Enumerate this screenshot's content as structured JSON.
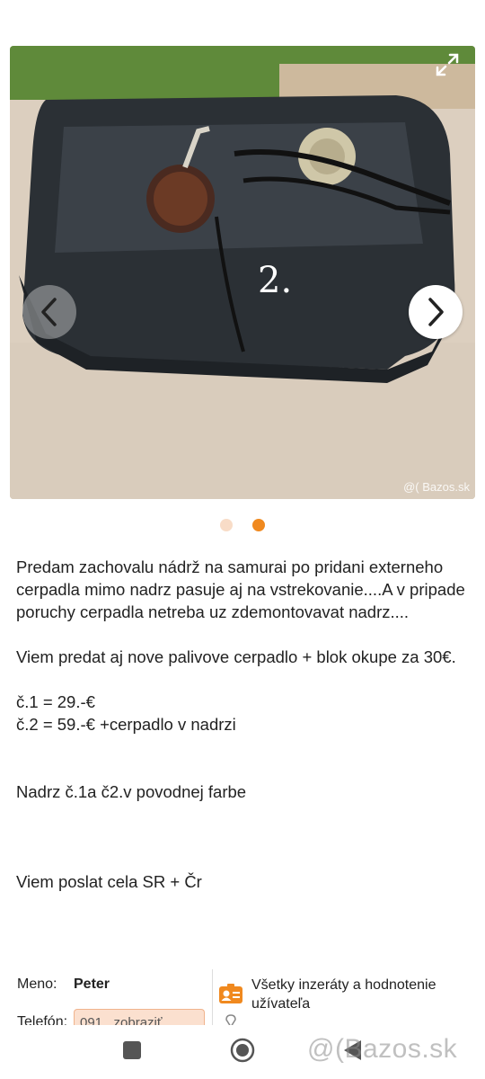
{
  "gallery": {
    "current_index": 2,
    "total": 2,
    "photo_label": "2.",
    "watermark": "@( Bazos.sk"
  },
  "description": {
    "paragraphs": [
      "Predam zachovalu nádrž na samurai po pridani externeho cerpadla mimo nadrz pasuje aj na vstrekovanie....A v pripade poruchy cerpadla netreba uz zdemontovavat nadrz....",
      "Viem predat aj nove palivove cerpadlo + blok okupe za 30€.",
      "č.1 = 29.-€\nč.2 = 59.-€ +cerpadlo v nadrzi",
      "Nadrz č.1a č2.v povodnej farbe",
      "Viem poslat cela SR + Čr"
    ]
  },
  "seller": {
    "name_label": "Meno:",
    "name": "Peter",
    "all_ads_link": "Všetky inzeráty a hodnotenie užívateľa",
    "phone_label": "Telefón:",
    "phone_partial": "091.. zobraziť"
  },
  "branding": {
    "overlay": "@(Bazos.sk"
  },
  "colors": {
    "accent": "#f0891f",
    "dot_inactive": "#f8dcc7",
    "phone_bg": "#fbe0cf"
  },
  "icons": {
    "prev": "chevron-left-icon",
    "next": "chevron-right-icon",
    "expand": "expand-icon",
    "user": "user-card-icon",
    "pin": "location-pin-icon"
  }
}
